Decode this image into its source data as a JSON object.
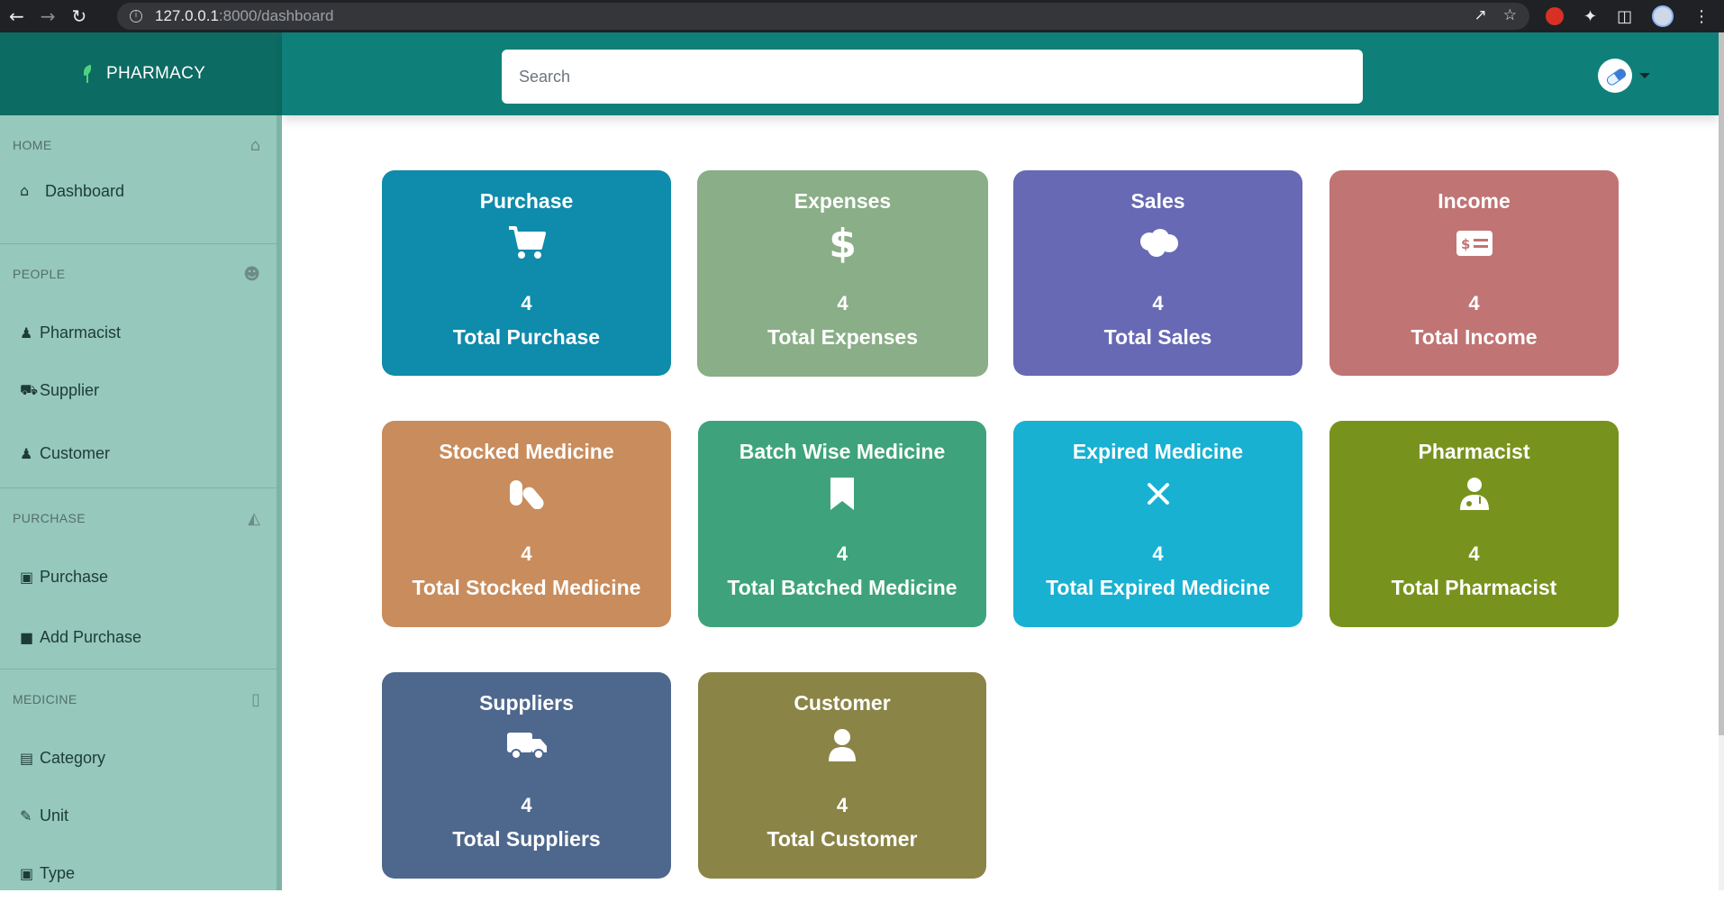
{
  "browser": {
    "url_host": "127.0.0.1",
    "url_path": ":8000/dashboard",
    "back_icon": "arrow-left-icon",
    "forward_icon": "arrow-right-icon",
    "reload_icon": "reload-icon"
  },
  "app": {
    "brand_name": "PHARMACY",
    "search_placeholder": "Search"
  },
  "sidebar": {
    "sections": [
      {
        "title": "HOME",
        "icon": "home-icon",
        "items": [
          {
            "label": "Dashboard",
            "icon": "home-icon"
          }
        ]
      },
      {
        "title": "PEOPLE",
        "icon": "user-icon",
        "items": [
          {
            "label": "Pharmacist",
            "icon": "doctor-icon"
          },
          {
            "label": "Supplier",
            "icon": "truck-icon"
          },
          {
            "label": "Customer",
            "icon": "user-icon"
          }
        ]
      },
      {
        "title": "PURCHASE",
        "icon": "cart-icon",
        "items": [
          {
            "label": "Purchase",
            "icon": "cart-icon"
          },
          {
            "label": "Add Purchase",
            "icon": "bag-icon"
          }
        ]
      },
      {
        "title": "MEDICINE",
        "icon": "tablet-icon",
        "items": [
          {
            "label": "Category",
            "icon": "category-icon"
          },
          {
            "label": "Unit",
            "icon": "brush-icon"
          },
          {
            "label": "Type",
            "icon": "box-icon"
          }
        ]
      }
    ]
  },
  "cards": [
    {
      "title": "Purchase",
      "icon": "cart-icon",
      "count": "4",
      "label": "Total Purchase",
      "color": "#0f8bab"
    },
    {
      "title": "Expenses",
      "icon": "dollar-icon",
      "count": "4",
      "label": "Total Expenses",
      "color": "#8aae87"
    },
    {
      "title": "Sales",
      "icon": "salesforce-cloud-icon",
      "count": "4",
      "label": "Total Sales",
      "color": "#6769b4"
    },
    {
      "title": "Income",
      "icon": "money-check-icon",
      "count": "4",
      "label": "Total Income",
      "color": "#c07474"
    },
    {
      "title": "Stocked Medicine",
      "icon": "pills-icon",
      "count": "4",
      "label": "Total Stocked Medicine",
      "color": "#c98c5c"
    },
    {
      "title": "Batch Wise Medicine",
      "icon": "bookmark-icon",
      "count": "4",
      "label": "Total Batched Medicine",
      "color": "#3ea37c"
    },
    {
      "title": "Expired Medicine",
      "icon": "x-icon",
      "count": "4",
      "label": "Total Expired Medicine",
      "color": "#18b1d2"
    },
    {
      "title": "Pharmacist",
      "icon": "doctor-icon",
      "count": "4",
      "label": "Total Pharmacist",
      "color": "#78931d"
    },
    {
      "title": "Suppliers",
      "icon": "truck-icon",
      "count": "4",
      "label": "Total Suppliers",
      "color": "#4e688d"
    },
    {
      "title": "Customer",
      "icon": "user-icon",
      "count": "4",
      "label": "Total Customer",
      "color": "#8a8447"
    }
  ]
}
